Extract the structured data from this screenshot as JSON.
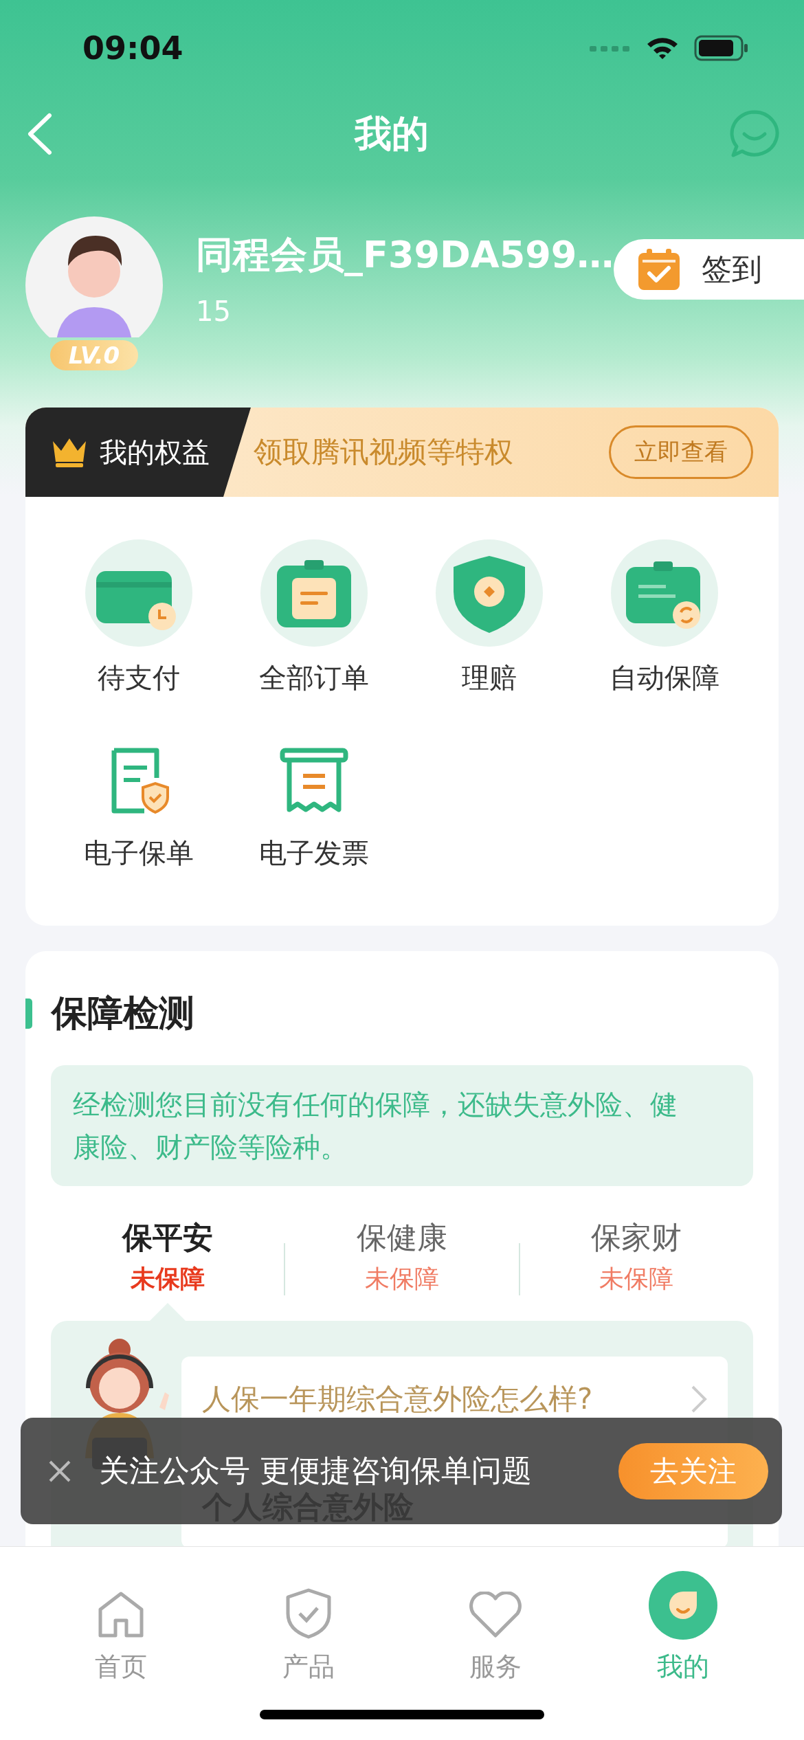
{
  "status_bar": {
    "time": "09:04"
  },
  "nav": {
    "title": "我的"
  },
  "profile": {
    "name": "同程会员_F39DA599…",
    "points": "15",
    "level": "LV.0",
    "checkin": "签到"
  },
  "benefits": {
    "title": "我的权益",
    "promo": "领取腾讯视频等特权",
    "button": "立即查看"
  },
  "services": [
    {
      "kind": "wallet",
      "label": "待支付"
    },
    {
      "kind": "orders",
      "label": "全部订单"
    },
    {
      "kind": "claim",
      "label": "理赔"
    },
    {
      "kind": "auto",
      "label": "自动保障"
    },
    {
      "kind": "policy",
      "label": "电子保单"
    },
    {
      "kind": "invoice",
      "label": "电子发票"
    }
  ],
  "coverage": {
    "title": "保障检测",
    "notice": "经检测您目前没有任何的保障，还缺失意外险、健康险、财产险等险种。",
    "tabs": [
      {
        "label": "保平安",
        "status": "未保障",
        "selected": true
      },
      {
        "label": "保健康",
        "status": "未保障",
        "selected": false
      },
      {
        "label": "保家财",
        "status": "未保障",
        "selected": false
      }
    ],
    "question": "人保一年期综合意外险怎么样?",
    "product": "个人综合意外险"
  },
  "toast": {
    "text": "关注公众号 更便捷咨询保单问题",
    "button": "去关注"
  },
  "tab_bar": [
    {
      "kind": "home",
      "label": "首页",
      "selected": false
    },
    {
      "kind": "product",
      "label": "产品",
      "selected": false
    },
    {
      "kind": "service",
      "label": "服务",
      "selected": false
    },
    {
      "kind": "mine",
      "label": "我的",
      "selected": true
    }
  ]
}
